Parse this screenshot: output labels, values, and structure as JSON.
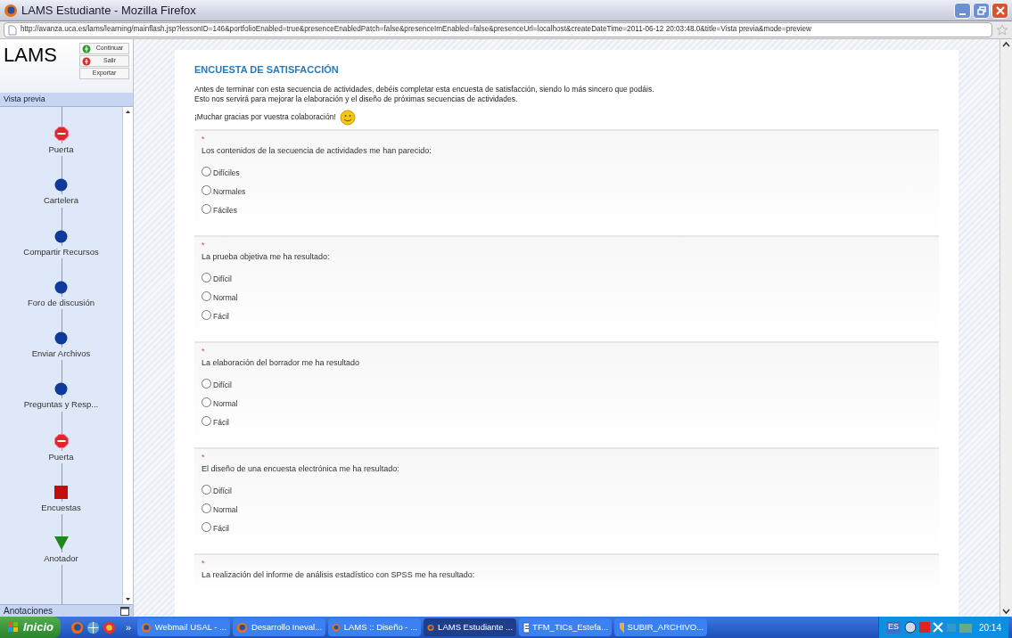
{
  "window": {
    "title": "LAMS Estudiante - Mozilla Firefox"
  },
  "address_bar": {
    "url": "http://avanza.uca.es/lams/learning/mainflash.jsp?lessonID=146&portfolioEnabled=true&presenceEnabledPatch=false&presenceImEnabled=false&presenceUrl=localhost&createDateTime=2011-06-12 20:03:48.0&title=Vista previa&mode=preview"
  },
  "sidebar": {
    "logo": "LAMS",
    "buttons": [
      {
        "label": "Continuar",
        "kind": "go"
      },
      {
        "label": "Salir",
        "kind": "stop"
      },
      {
        "label": "Exportar",
        "kind": "plain"
      }
    ],
    "panel_title": "Vista previa",
    "items": [
      {
        "label": "Puerta",
        "kind": "gate"
      },
      {
        "label": "Cartelera",
        "kind": "activity"
      },
      {
        "label": "Compartir Recursos",
        "kind": "activity"
      },
      {
        "label": "Foro de discusión",
        "kind": "activity"
      },
      {
        "label": "Enviar Archivos",
        "kind": "activity"
      },
      {
        "label": "Preguntas y Resp...",
        "kind": "activity"
      },
      {
        "label": "Puerta",
        "kind": "gate"
      },
      {
        "label": "Encuestas",
        "kind": "current"
      },
      {
        "label": "Anotador",
        "kind": "next"
      }
    ],
    "notes_title": "Anotaciones"
  },
  "survey": {
    "title": "ENCUESTA DE SATISFACCIÓN",
    "intro": [
      "Antes de terminar con esta secuencia de actividades, debéis completar esta encuesta de satisfacción, siendo lo más sincero que podáis.",
      "Esto nos servirá para mejorar la elaboración y el diseño de próximas secuencias de actividades."
    ],
    "thanks": "¡Muchar gracias por vuestra colaboración!",
    "questions": [
      {
        "required": "*",
        "text": "Los contenidos de la secuencia de actividades me han parecido:",
        "options": [
          {
            "label": "Difíciles",
            "selected": false
          },
          {
            "label": "Normales",
            "selected": false
          },
          {
            "label": "Fáciles",
            "selected": false
          }
        ]
      },
      {
        "required": "*",
        "text": "La prueba objetiva me ha resultado:",
        "options": [
          {
            "label": "Difícil",
            "selected": false
          },
          {
            "label": "Normal",
            "selected": false
          },
          {
            "label": "Fácil",
            "selected": false
          }
        ]
      },
      {
        "required": "*",
        "text": "La elaboración del borrador me ha resultado",
        "options": [
          {
            "label": "Difícil",
            "selected": false
          },
          {
            "label": "Normal",
            "selected": false
          },
          {
            "label": "Fácil",
            "selected": false
          }
        ]
      },
      {
        "required": "*",
        "text": "El diseño de una encuesta electrónica me ha resultado:",
        "options": [
          {
            "label": "Difícil",
            "selected": false
          },
          {
            "label": "Normal",
            "selected": false
          },
          {
            "label": "Fácil",
            "selected": false
          }
        ]
      },
      {
        "required": "*",
        "text": "La realización del informe de análisis estadístico con SPSS me ha resultado:"
      }
    ]
  },
  "taskbar": {
    "start": "Inicio",
    "overflow": "»",
    "tasks": [
      {
        "label": "Webmail USAL - ...",
        "kind": "browser",
        "selected": false
      },
      {
        "label": "Desarrollo Ineval...",
        "kind": "browser",
        "selected": false
      },
      {
        "label": "LAMS :: Diseño - ...",
        "kind": "browser",
        "selected": false
      },
      {
        "label": "LAMS Estudiante ...",
        "kind": "browser",
        "selected": true
      },
      {
        "label": "TFM_TICs_Estefa...",
        "kind": "document",
        "selected": false
      },
      {
        "label": "SUBIR_ARCHIVO...",
        "kind": "upload",
        "selected": false
      }
    ],
    "language": "ES",
    "clock": "20:14"
  }
}
